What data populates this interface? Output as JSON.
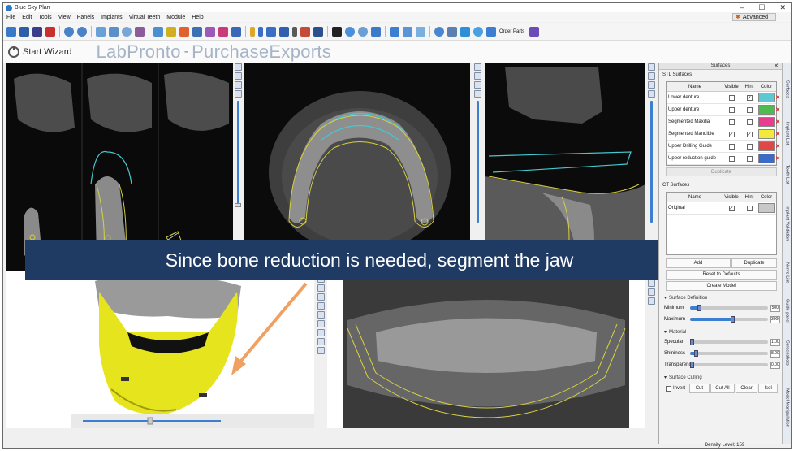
{
  "window": {
    "title": "Blue Sky Plan",
    "controls": [
      "–",
      "☐",
      "✕"
    ]
  },
  "menu": [
    "File",
    "Edit",
    "Tools",
    "View",
    "Panels",
    "Implants",
    "Virtual Teeth",
    "Module",
    "Help"
  ],
  "advanced_label": "Advanced",
  "toolbar": {
    "order_parts": "Order Parts"
  },
  "wizard": {
    "label": "Start Wizard"
  },
  "brand": {
    "left": "LabPronto",
    "sep": "-",
    "right": "PurchaseExports"
  },
  "banner": "Since bone reduction is needed, segment the jaw",
  "panel": {
    "title": "Surfaces",
    "stl_label": "STL Surfaces",
    "headers": {
      "name": "Name",
      "visible": "Visible",
      "hint": "Hint",
      "color": "Color"
    },
    "stl_rows": [
      {
        "name": "Lower denture",
        "visible": "",
        "hint": "✓",
        "color": "#5bc8d2"
      },
      {
        "name": "Upper denture",
        "visible": "",
        "hint": "",
        "color": "#4dbb4d"
      },
      {
        "name": "Segmented Maxilla",
        "visible": "",
        "hint": "",
        "color": "#e83c8e"
      },
      {
        "name": "Segmented Mandible",
        "visible": "✓",
        "hint": "✓",
        "color": "#f2ea3a"
      },
      {
        "name": "Upper Drilling Guide",
        "visible": "",
        "hint": "",
        "color": "#e04848"
      },
      {
        "name": "Upper reduction guide",
        "visible": "",
        "hint": "",
        "color": "#3d6ac4"
      }
    ],
    "duplicate_top": "Duplicate",
    "ct_label": "CT Surfaces",
    "ct_rows": [
      {
        "name": "Original",
        "visible": "✓",
        "hint": "",
        "color": "#c8c8c8"
      }
    ],
    "add": "Add",
    "duplicate": "Duplicate",
    "reset": "Reset to Defaults",
    "create_model": "Create Model",
    "surface_definition": "Surface Definition",
    "minimum_label": "Minimum",
    "minimum_value": "500",
    "minimum_level": 0.12,
    "maximum_label": "Maximum",
    "maximum_value": "3000",
    "maximum_level": 0.55,
    "material": "Material",
    "specular_label": "Specular",
    "specular_value": "1.00",
    "specular_level": 0.02,
    "shininess_label": "Shininess",
    "shininess_value": "8.00",
    "shininess_level": 0.08,
    "transparency_label": "Transparency",
    "transparency_value": "0.00",
    "transparency_level": 0.01,
    "culling": "Surface Culling",
    "invert": "Invert",
    "cut": "Cut",
    "cut_all": "Cut All",
    "clear": "Clear",
    "isolate": "Isol"
  },
  "vtabs": [
    "Surfaces",
    "Implant List",
    "Tooth List",
    "Implant Validation",
    "Nerve List",
    "Guide panel",
    "Screenshots",
    "Model Manipulation"
  ],
  "status": "Density Level: 159"
}
